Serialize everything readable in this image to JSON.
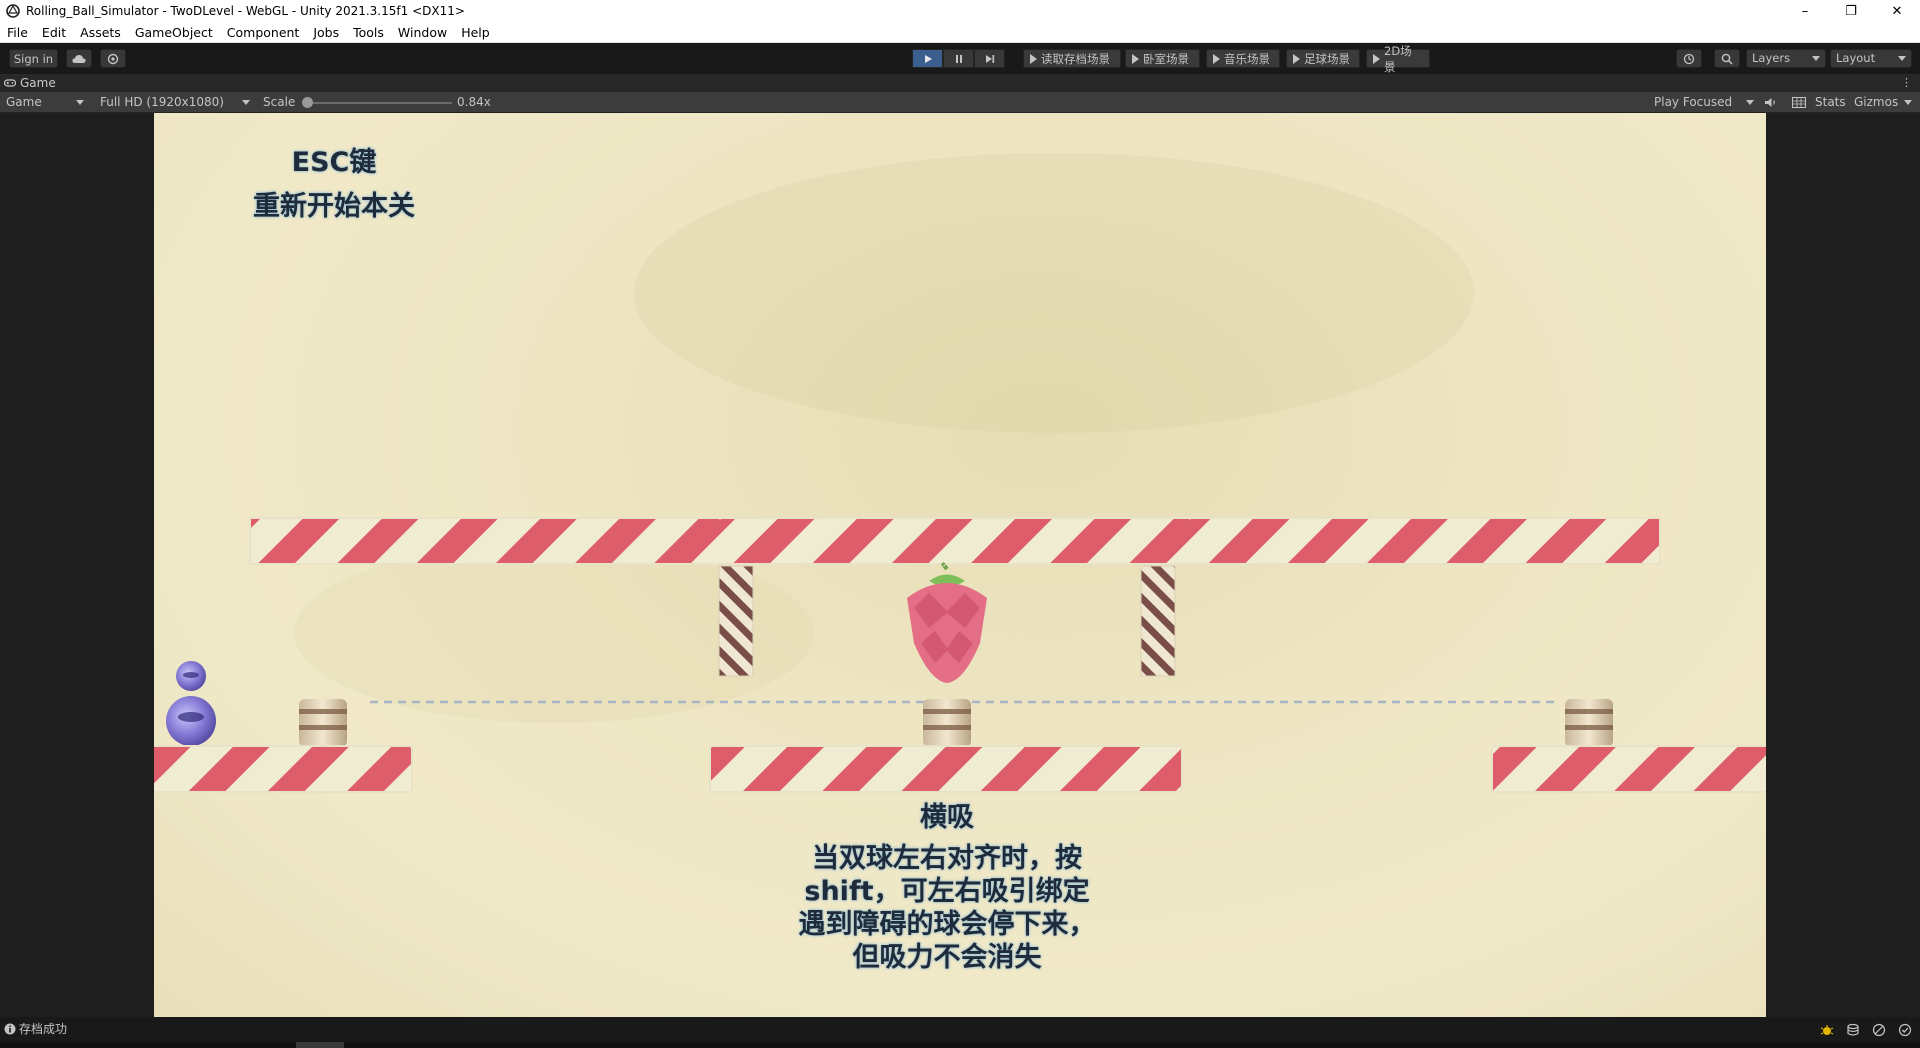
{
  "window": {
    "title": "Rolling_Ball_Simulator - TwoDLevel - WebGL - Unity 2021.3.15f1 <DX11>",
    "controls": [
      "–",
      "❐",
      "✕"
    ]
  },
  "menu": [
    "File",
    "Edit",
    "Assets",
    "GameObject",
    "Component",
    "Jobs",
    "Tools",
    "Window",
    "Help"
  ],
  "toolbar": {
    "sign_in": "Sign in",
    "scene_buttons": [
      "读取存档场景",
      "卧室场景",
      "音乐场景",
      "足球场景",
      "2D场景"
    ],
    "layers": "Layers",
    "layout": "Layout"
  },
  "game_tab": {
    "label": "Game"
  },
  "game_controls": {
    "display": "Game",
    "resolution": "Full HD (1920x1080)",
    "scale_label": "Scale",
    "scale_value": "0.84x",
    "scale_fraction": 0.0,
    "play_mode": "Play Focused",
    "stats": "Stats",
    "gizmos": "Gizmos"
  },
  "game": {
    "hint_title": "ESC键",
    "hint_sub": "重新开始本关",
    "mechanic_title": "横吸",
    "mechanic_lines": [
      "当双球左右对齐时，按",
      "shift，可左右吸引绑定",
      "遇到障碍的球会停下来，",
      "但吸力不会消失"
    ]
  },
  "status": {
    "message": "存档成功"
  },
  "colors": {
    "stripe_red": "#de5d6a",
    "stripe_cream": "#f0ecd2",
    "pole_brown": "#7a4d48",
    "ball_purple": "#7b6fd8",
    "play_active": "#3a5f8f"
  }
}
